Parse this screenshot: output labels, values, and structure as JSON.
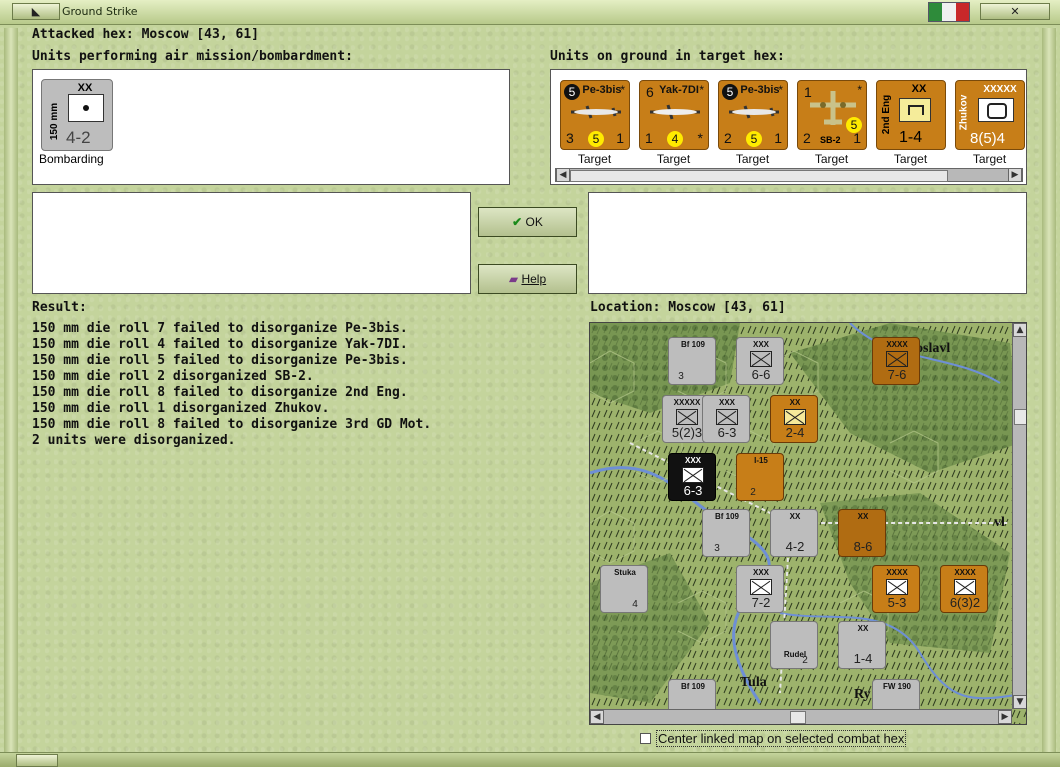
{
  "window": {
    "title": "Ground Strike"
  },
  "header": {
    "attacked_hex": "Attacked hex: Moscow  [43, 61]"
  },
  "air_units": {
    "label": "Units performing air mission/bombardment:",
    "units": [
      {
        "size": "XX",
        "type": "150 mm",
        "strength": "4-2",
        "caption": "Bombarding"
      }
    ]
  },
  "ground_units": {
    "label": "Units on ground in target hex:",
    "units": [
      {
        "name": "Pe-3bis",
        "ring": "5",
        "corner": "",
        "left": "3",
        "mid": "5",
        "right": "1",
        "star": "*",
        "caption": "Target"
      },
      {
        "name": "Yak-7DI",
        "ring": "",
        "corner": "6",
        "left": "1",
        "mid": "4",
        "right": "*",
        "star": "*",
        "caption": "Target"
      },
      {
        "name": "Pe-3bis",
        "ring": "5",
        "corner": "",
        "left": "2",
        "mid": "5",
        "right": "1",
        "star": "*",
        "caption": "Target"
      },
      {
        "name": "SB-2",
        "ring": "",
        "corner": "1",
        "left": "2",
        "mid": "5",
        "right": "1",
        "star": "*",
        "caption": "Target"
      },
      {
        "name": "2nd Eng",
        "size": "XX",
        "strength": "1-4",
        "caption": "Target"
      },
      {
        "name": "Zhukov",
        "size": "XXXXX",
        "strength": "8(5)4",
        "caption": "Target"
      }
    ]
  },
  "buttons": {
    "ok": "OK",
    "help": "Help"
  },
  "result": {
    "label": "Result:",
    "lines": [
      "150 mm die roll 7 failed to disorganize Pe-3bis.",
      "150 mm die roll 4 failed to disorganize Yak-7DI.",
      "150 mm die roll 5 failed to disorganize Pe-3bis.",
      "150 mm die roll 2 disorganized SB-2.",
      "150 mm die roll 8 failed to disorganize 2nd Eng.",
      "150 mm die roll 1 disorganized Zhukov.",
      "150 mm die roll 8 failed to disorganize 3rd GD Mot.",
      "2 units were disorganized."
    ]
  },
  "location": {
    "label": "Location:  Moscow  [43, 61]"
  },
  "map": {
    "place_names": [
      "oslavl",
      "Tula",
      "Ry",
      "vl"
    ],
    "counters": [
      {
        "top": "Bf 109",
        "val": "3",
        "color": "gray"
      },
      {
        "top": "XXX",
        "val": "6-6",
        "color": "gray"
      },
      {
        "top": "XXXX",
        "val": "7-6",
        "color": "orange"
      },
      {
        "top": "XXXXX",
        "val": "5(2)3",
        "color": "gray"
      },
      {
        "top": "XXX",
        "val": "6-3",
        "color": "gray"
      },
      {
        "top": "XX",
        "val": "2-4",
        "color": "orange"
      },
      {
        "top": "XXX",
        "val": "6-3",
        "color": "black"
      },
      {
        "top": "I-15",
        "val": "2",
        "color": "orange"
      },
      {
        "top": "Bf 109",
        "val": "3",
        "color": "gray"
      },
      {
        "top": "XX",
        "val": "4-2",
        "color": "gray"
      },
      {
        "top": "XX",
        "val": "8-6",
        "color": "orange"
      },
      {
        "top": "Stuka",
        "val": "4",
        "color": "gray"
      },
      {
        "top": "XXX",
        "val": "7-2",
        "color": "gray"
      },
      {
        "top": "XXXX",
        "val": "5-3",
        "color": "orange"
      },
      {
        "top": "XXXX",
        "val": "6(3)2",
        "color": "orange"
      },
      {
        "top": "Rudel",
        "val": "2",
        "color": "gray"
      },
      {
        "top": "XX",
        "val": "1-4",
        "color": "gray"
      },
      {
        "top": "Bf 109",
        "val": "",
        "color": "gray"
      },
      {
        "top": "FW 190",
        "val": "",
        "color": "gray"
      }
    ]
  },
  "options": {
    "center_linked_map": "Center linked map on selected combat hex"
  }
}
